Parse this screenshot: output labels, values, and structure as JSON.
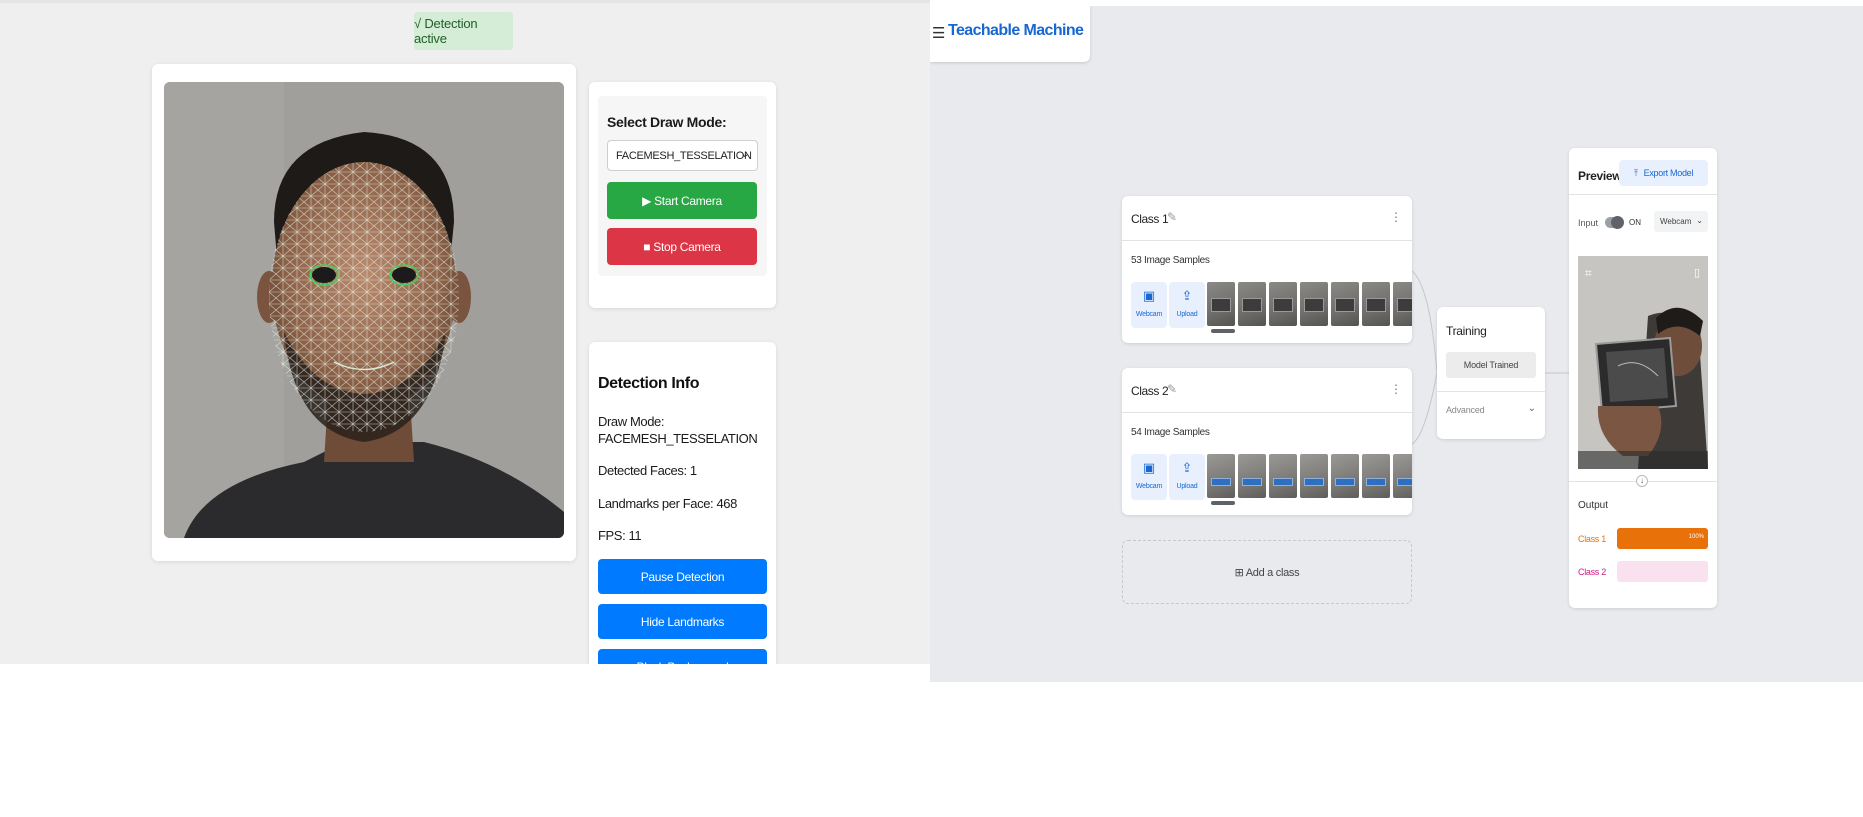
{
  "face_app": {
    "status": "√ Detection active",
    "controls": {
      "draw_mode_label": "Select Draw Mode:",
      "draw_mode_value": "FACEMESH_TESSELATION",
      "start_button": "▶ Start Camera",
      "stop_button": "■ Stop Camera"
    },
    "info": {
      "title": "Detection Info",
      "draw_mode_label": "Draw Mode:",
      "draw_mode_value": "FACEMESH_TESSELATION",
      "detected_faces": "Detected Faces: 1",
      "landmarks": "Landmarks per Face: 468",
      "fps": "FPS: 11",
      "pause_button": "Pause Detection",
      "hide_button": "Hide Landmarks",
      "black_bg_button": "Black Background"
    },
    "colors": {
      "start": "#28a745",
      "stop": "#dc3545",
      "primary": "#007bff",
      "status_bg": "#d5ecd6"
    }
  },
  "teachable_machine": {
    "menu_icon": "☰",
    "title": "Teachable Machine",
    "classes": [
      {
        "name": "Class 1",
        "samples": "53 Image Samples",
        "webcam_label": "Webcam",
        "upload_label": "Upload"
      },
      {
        "name": "Class 2",
        "samples": "54 Image Samples",
        "webcam_label": "Webcam",
        "upload_label": "Upload"
      }
    ],
    "add_class": "⊞ Add a class",
    "training": {
      "title": "Training",
      "status_button": "Model Trained",
      "advanced": "Advanced"
    },
    "preview": {
      "title": "Preview",
      "export_button": "Export Model",
      "input_label": "Input",
      "toggle_state": "ON",
      "source_select": "Webcam",
      "output_label": "Output",
      "outputs": [
        {
          "name": "Class 1",
          "percent": 100,
          "percent_label": "100%",
          "color": "#e8710a"
        },
        {
          "name": "Class 2",
          "percent": 0,
          "percent_label": "",
          "color": "#d01884"
        }
      ]
    },
    "colors": {
      "accent": "#1967d2"
    }
  }
}
